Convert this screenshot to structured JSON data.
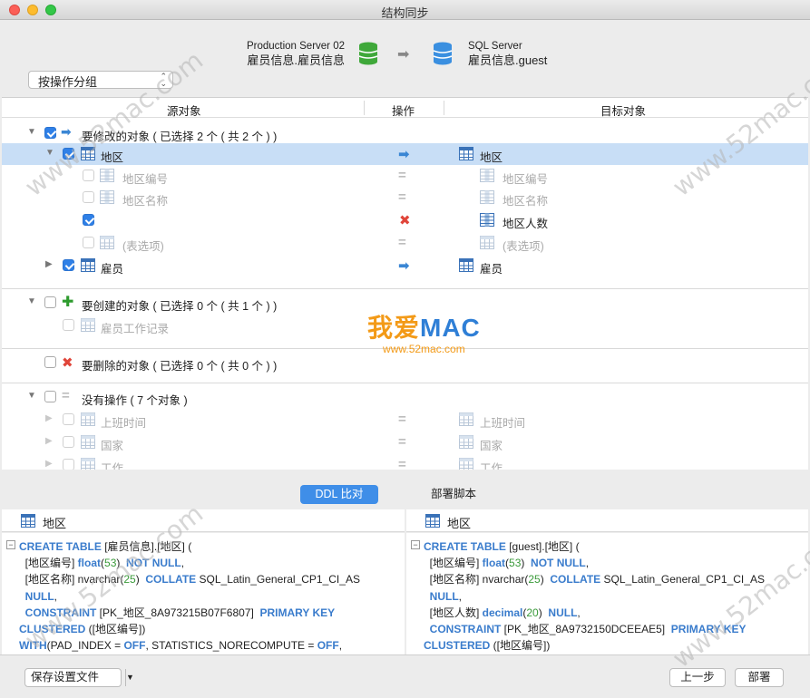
{
  "window": {
    "title": "结构同步"
  },
  "header": {
    "group_select": "按操作分组",
    "source": {
      "server": "Production Server 02",
      "object": "雇员信息.雇员信息"
    },
    "target": {
      "server": "SQL Server",
      "object": "雇员信息.guest"
    }
  },
  "columns": {
    "source": "源对象",
    "operation": "操作",
    "target": "目标对象"
  },
  "groups": {
    "modify": {
      "label": "要修改的对象 ( 已选择 2 个 ( 共 2 个 ) )"
    },
    "create": {
      "label": "要创建的对象 ( 已选择 0 个 ( 共 1 个 ) )"
    },
    "delete": {
      "label": "要删除的对象 ( 已选择 0 个 ( 共 0 个 ) )"
    },
    "none": {
      "label": "没有操作 ( 7 个对象 )"
    }
  },
  "rows": {
    "region": {
      "src": "地区",
      "tgt": "地区"
    },
    "region_code": {
      "src": "地区编号",
      "tgt": "地区编号"
    },
    "region_name": {
      "src": "地区名称",
      "tgt": "地区名称"
    },
    "region_pop": {
      "src": "",
      "tgt": "地区人数"
    },
    "table_options": {
      "src": "(表选项)",
      "tgt": "(表选项)"
    },
    "employee": {
      "src": "雇员",
      "tgt": "雇员"
    },
    "employee_log": {
      "src": "雇员工作记录"
    },
    "shift_time": {
      "src": "上班时间",
      "tgt": "上班时间"
    },
    "country": {
      "src": "国家",
      "tgt": "国家"
    },
    "job": {
      "src": "工作",
      "tgt": "工作"
    }
  },
  "watermark": {
    "text": "www.52mac.com",
    "logo_a": "我爱",
    "logo_b": "MAC",
    "logo_url": "www.52mac.com"
  },
  "tabs": {
    "ddl": "DDL 比对",
    "deploy": "部署脚本"
  },
  "ddl": {
    "left_title": "地区",
    "right_title": "地区",
    "left": {
      "l1a": "CREATE TABLE",
      "l1b": " [雇员信息].[地区] (",
      "l2a": "  [地区编号] ",
      "l2b": "float",
      "l2c": "(",
      "l2d": "53",
      "l2e": ")  ",
      "l2f": "NOT NULL",
      "l2g": ",",
      "l3a": "  [地区名称] nvarchar(",
      "l3b": "25",
      "l3c": ")  ",
      "l3d": "COLLATE",
      "l3e": " SQL_Latin_General_CP1_CI_AS",
      "l4a": "  NULL",
      "l4b": ",",
      "l5a": "  CONSTRAINT",
      "l5b": " [PK_地区_8A973215B07F6807]  ",
      "l5c": "PRIMARY KEY",
      "l6a": "CLUSTERED",
      "l6b": " ([地区编号])",
      "l7a": "WITH",
      "l7b": "(PAD_INDEX = ",
      "l7c": "OFF",
      "l7d": ", STATISTICS_NORECOMPUTE = ",
      "l7e": "OFF",
      "l7f": ","
    },
    "right": {
      "l1a": "CREATE TABLE",
      "l1b": " [guest].[地区] (",
      "l2a": "  [地区编号] ",
      "l2b": "float",
      "l2c": "(",
      "l2d": "53",
      "l2e": ")  ",
      "l2f": "NOT NULL",
      "l2g": ",",
      "l3a": "  [地区名称] nvarchar(",
      "l3b": "25",
      "l3c": ")  ",
      "l3d": "COLLATE",
      "l3e": " SQL_Latin_General_CP1_CI_AS",
      "l4a": "  NULL",
      "l4b": ",",
      "l5a": "  [地区人数] ",
      "l5b": "decimal",
      "l5c": "(",
      "l5d": "20",
      "l5e": ")  ",
      "l5f": "NULL",
      "l5g": ",",
      "l6a": "  CONSTRAINT",
      "l6b": " [PK_地区_8A9732150DCEEAE5]  ",
      "l6c": "PRIMARY KEY",
      "l7a": "CLUSTERED",
      "l7b": " ([地区编号])"
    }
  },
  "footer": {
    "save": "保存设置文件",
    "prev": "上一步",
    "deploy": "部署"
  },
  "colors": {
    "accent": "#3f8ee8",
    "selection": "#c8def6",
    "delete": "#e0453a",
    "add": "#2e9b2e"
  }
}
